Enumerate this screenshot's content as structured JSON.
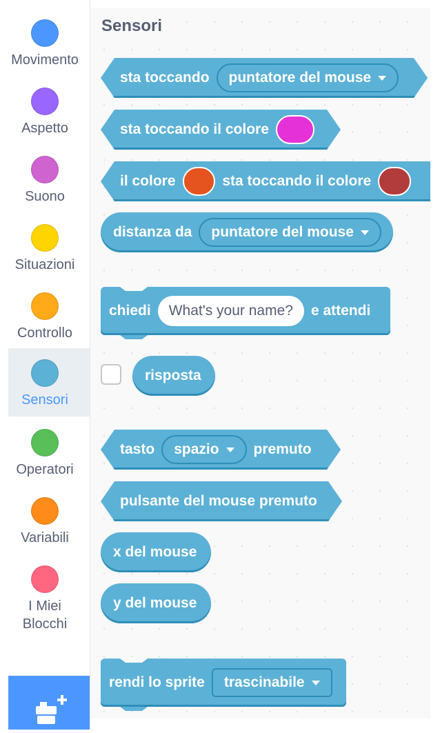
{
  "categories": [
    {
      "label": "Movimento",
      "color": "#4c97ff",
      "active": false
    },
    {
      "label": "Aspetto",
      "color": "#9966ff",
      "active": false
    },
    {
      "label": "Suono",
      "color": "#cf63cf",
      "active": false
    },
    {
      "label": "Situazioni",
      "color": "#ffd500",
      "active": false
    },
    {
      "label": "Controllo",
      "color": "#ffab19",
      "active": false
    },
    {
      "label": "Sensori",
      "color": "#5cb1d6",
      "active": true
    },
    {
      "label": "Operatori",
      "color": "#59c059",
      "active": false
    },
    {
      "label": "Variabili",
      "color": "#ff8c1a",
      "active": false
    },
    {
      "label": "I Miei\nBlocchi",
      "color": "#ff6680",
      "active": false
    }
  ],
  "palette_title": "Sensori",
  "blocks": {
    "touching": {
      "text": "sta toccando",
      "dropdown": "puntatore del mouse"
    },
    "touching_color": {
      "text": "sta toccando il colore",
      "color": "#e532d8"
    },
    "color_touching": {
      "text1": "il colore",
      "color1": "#e5531f",
      "text2": "sta toccando il colore",
      "color2": "#b23b3b"
    },
    "distance": {
      "text": "distanza da",
      "dropdown": "puntatore del mouse"
    },
    "ask": {
      "text1": "chiedi",
      "input": "What's your name?",
      "text2": "e attendi"
    },
    "answer": {
      "text": "risposta"
    },
    "key_pressed": {
      "text1": "tasto",
      "dropdown": "spazio",
      "text2": "premuto"
    },
    "mouse_down": {
      "text": "pulsante del mouse premuto"
    },
    "mouse_x": {
      "text": "x del mouse"
    },
    "mouse_y": {
      "text": "y del mouse"
    },
    "drag_mode": {
      "text": "rendi lo sprite",
      "dropdown": "trascinabile"
    }
  },
  "extension_button": {
    "icon": "add-extension-icon"
  }
}
